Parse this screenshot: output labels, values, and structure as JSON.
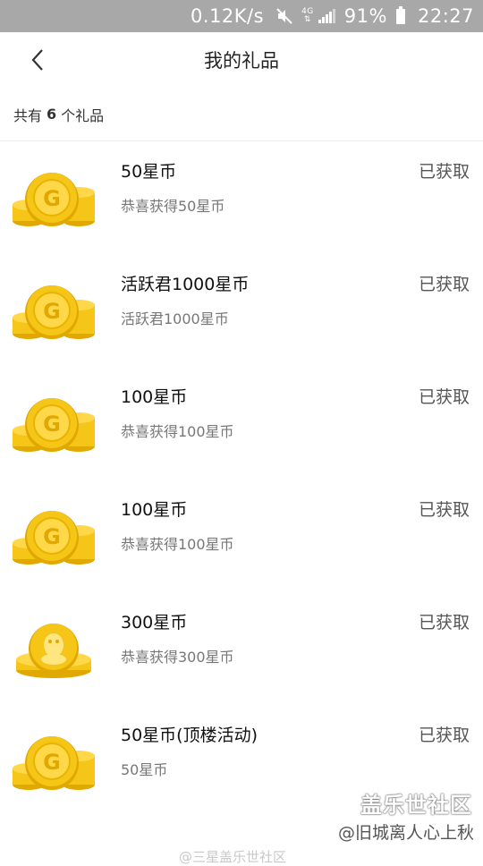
{
  "status_bar": {
    "net_speed": "0.12K/s",
    "network": "4G",
    "battery": "91%",
    "time": "22:27"
  },
  "header": {
    "title": "我的礼品"
  },
  "summary": {
    "prefix": "共有",
    "count": "6",
    "suffix": "个礼品"
  },
  "gifts": [
    {
      "title": "50星币",
      "desc": "恭喜获得50星币",
      "status": "已获取",
      "icon": "gold-coin-stack-icon"
    },
    {
      "title": "活跃君1000星币",
      "desc": "活跃君1000星币",
      "status": "已获取",
      "icon": "gold-coin-stack-icon"
    },
    {
      "title": "100星币",
      "desc": "恭喜获得100星币",
      "status": "已获取",
      "icon": "gold-coin-stack-icon"
    },
    {
      "title": "100星币",
      "desc": "恭喜获得100星币",
      "status": "已获取",
      "icon": "gold-coin-stack-icon"
    },
    {
      "title": "300星币",
      "desc": "恭喜获得300星币",
      "status": "已获取",
      "icon": "qq-coin-icon"
    },
    {
      "title": "50星币(顶楼活动)",
      "desc": "50星币",
      "status": "已获取",
      "icon": "gold-coin-stack-icon"
    }
  ],
  "watermark": {
    "brand": "盖乐世社区",
    "author": "@旧城离人心上秋",
    "footer": "@三星盖乐世社区"
  },
  "colors": {
    "status_bar_bg": "#a8a8a8",
    "coin_gold": "#f5c518",
    "coin_dark": "#e0a800"
  }
}
